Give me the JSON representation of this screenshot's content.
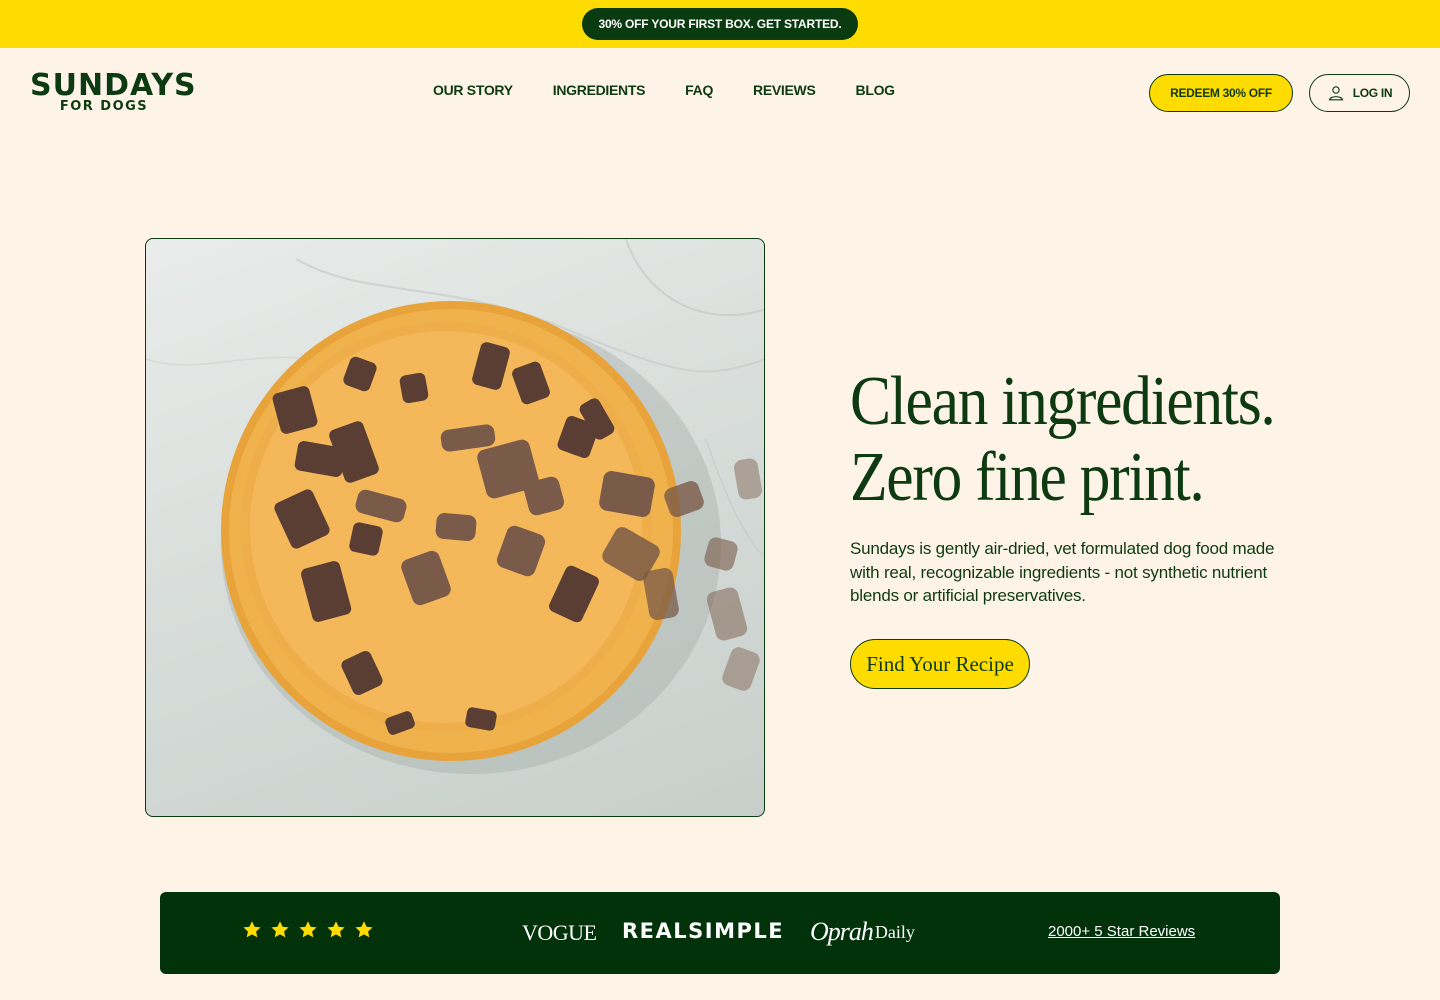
{
  "promo": {
    "text": "30% OFF YOUR FIRST BOX. GET STARTED."
  },
  "header": {
    "logo_line1": "SUNDAYS",
    "logo_line2": "FOR DOGS",
    "nav": [
      "OUR STORY",
      "INGREDIENTS",
      "FAQ",
      "REVIEWS",
      "BLOG"
    ],
    "redeem_label": "REDEEM 30% OFF",
    "login_label": "LOG IN"
  },
  "hero": {
    "title_line1": "Clean ingredients.",
    "title_line2": "Zero fine print.",
    "subtitle": "Sundays is gently air-dried, vet formulated dog food made with real, recognizable ingredients - not synthetic nutrient blends or artificial preservatives.",
    "cta_label": "Find Your Recipe",
    "image_icon": "food-bowl-image"
  },
  "press": {
    "stars_count": 5,
    "vogue": "VOGUE",
    "realsimple": "REALSIMPLE",
    "oprah_script": "Oprah",
    "oprah_daily": "Daily",
    "reviews_label": "2000+ 5 Star Reviews"
  },
  "colors": {
    "background": "#fdf4e7",
    "brand_green": "#0e3a12",
    "press_bar": "#01320a",
    "accent_yellow": "#ffdc00"
  }
}
